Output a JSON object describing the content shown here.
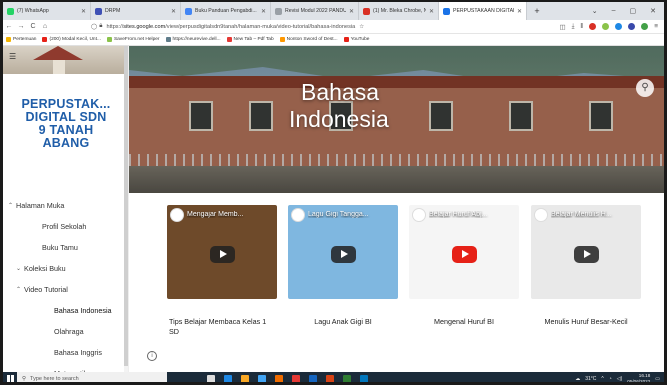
{
  "browser": {
    "tabs": [
      {
        "title": "(7) WhatsApp",
        "color": "#25d366"
      },
      {
        "title": "DRPM",
        "color": "#3f51b5"
      },
      {
        "title": "Buku Panduan Pengabdi...",
        "color": "#4285f4"
      },
      {
        "title": "Revisi Modul 2022 PANDUAN...",
        "color": "#9aa0a6"
      },
      {
        "title": "(1) Mr. Bleka Chrobe, Nich...",
        "color": "#d93025"
      },
      {
        "title": "PERPUSTAKAAN DIGITAL",
        "color": "#1a73e8"
      }
    ],
    "new_tab": "+",
    "window_controls": [
      "⌄",
      "–",
      "▢",
      "✕"
    ],
    "address": {
      "prefix": "https://",
      "host": "sites.google.com",
      "path": "/view/perpusdigitalsdn9tanah/halaman-muka/video-tutorial/bahasa-indonesia"
    },
    "bookmarks": [
      {
        "label": "Pertemuan",
        "color": "#f4b400"
      },
      {
        "label": "(200) Modal Kecil, Unt...",
        "color": "#e62117"
      },
      {
        "label": "SaveFrom.net Helper",
        "color": "#8bc34a"
      },
      {
        "label": "https://neurevive.dell...",
        "color": "#607d8b"
      },
      {
        "label": "New Tab – Pdf Tab",
        "color": "#e53935"
      },
      {
        "label": "Nonton Sword of Dest...",
        "color": "#ff9800"
      },
      {
        "label": "YouTube",
        "color": "#e62117"
      }
    ]
  },
  "site": {
    "title_lines": [
      "PERPUSTAK...",
      "DIGITAL SDN",
      "9 TANAH",
      "ABANG"
    ],
    "page_title_lines": [
      "Bahasa",
      "Indonesia"
    ]
  },
  "nav": [
    {
      "label": "Halaman Muka",
      "level": "l0",
      "caret": "^"
    },
    {
      "label": "Profil Sekolah",
      "level": "l1",
      "caret": ""
    },
    {
      "label": "Buku Tamu",
      "level": "l1",
      "caret": ""
    },
    {
      "label": "Koleksi Buku",
      "level": "l1b",
      "caret": "v"
    },
    {
      "label": "Video Tutorial",
      "level": "l1b",
      "caret": "^"
    },
    {
      "label": "Bahasa Indonesia",
      "level": "l2",
      "caret": "",
      "selected": true
    },
    {
      "label": "Olahraga",
      "level": "l2",
      "caret": ""
    },
    {
      "label": "Bahasa Inggris",
      "level": "l2",
      "caret": ""
    },
    {
      "label": "Matematika",
      "level": "l2",
      "caret": ""
    }
  ],
  "videos": [
    {
      "thumb_title": "Mengajar Memb...",
      "caption": "Tips Belajar Membaca Kelas 1 SD",
      "bg": "#6e4a2a",
      "play": "dark"
    },
    {
      "thumb_title": "Lagu Gigi Tangga...",
      "caption": "Lagu Anak Gigi BI",
      "bg": "#7fb7e0",
      "play": "dark"
    },
    {
      "thumb_title": "Belajar Huruf Abj...",
      "caption": "Mengenal Huruf BI",
      "bg": "#f5f5f5",
      "play": "red"
    },
    {
      "thumb_title": "Belajar Menulis H...",
      "caption": "Menulis Huruf Besar-Kecil",
      "bg": "#e9e9e9",
      "play": "dark"
    }
  ],
  "taskbar": {
    "search_placeholder": "Type here to search",
    "weather": "31°C",
    "time": "16.18",
    "date": "05/06/2022"
  }
}
